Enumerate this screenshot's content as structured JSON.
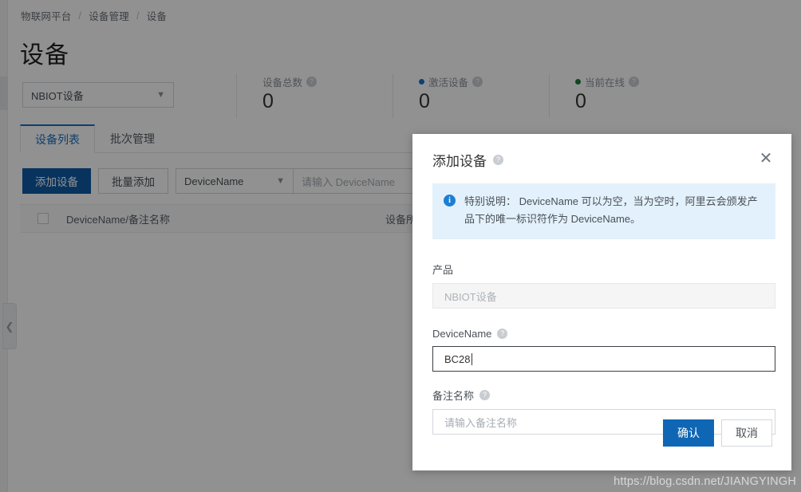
{
  "breadcrumb": {
    "items": [
      "物联网平台",
      "设备管理",
      "设备"
    ],
    "separator": "/"
  },
  "page": {
    "title": "设备"
  },
  "product_filter": {
    "value": "NBIOT设备",
    "caret": "chevron-down-icon"
  },
  "stats": [
    {
      "label": "设备总数",
      "value": "0",
      "dot_color": "",
      "help": "?"
    },
    {
      "label": "激活设备",
      "value": "0",
      "dot_color": "#1672c8",
      "help": "?"
    },
    {
      "label": "当前在线",
      "value": "0",
      "dot_color": "#207a3c",
      "help": "?"
    }
  ],
  "tabs": [
    {
      "label": "设备列表",
      "active": true
    },
    {
      "label": "批次管理",
      "active": false
    }
  ],
  "toolbar": {
    "add_device_label": "添加设备",
    "batch_add_label": "批量添加",
    "filter_field": "DeviceName",
    "search_placeholder": "请输入 DeviceName"
  },
  "table": {
    "columns": [
      "DeviceName/备注名称",
      "设备所属"
    ]
  },
  "sidebar": {
    "collapse_icon": "chevron-left-icon"
  },
  "modal": {
    "title": "添加设备",
    "title_help": "?",
    "close_icon": "✕",
    "alert": {
      "icon": "i",
      "text": "特别说明： DeviceName 可以为空，当为空时，阿里云会颁发产品下的唯一标识符作为 DeviceName。"
    },
    "fields": {
      "product": {
        "label": "产品",
        "value": "NBIOT设备",
        "disabled": true
      },
      "device_name": {
        "label": "DeviceName",
        "help": "?",
        "value": "BC28"
      },
      "nickname": {
        "label": "备注名称",
        "help": "?",
        "placeholder": "请输入备注名称",
        "value": ""
      }
    },
    "confirm_label": "确认",
    "cancel_label": "取消"
  },
  "watermark": {
    "text": "https://blog.csdn.net/JIANGYINGH"
  },
  "colors": {
    "primary": "#0f5ba6",
    "modal_primary": "#0f66b4",
    "tab_active": "#1a6fc4",
    "alert_bg": "#e3f1fc",
    "info_icon": "#1c7fd4",
    "dot_active": "#1672c8",
    "dot_online": "#207a3c"
  }
}
